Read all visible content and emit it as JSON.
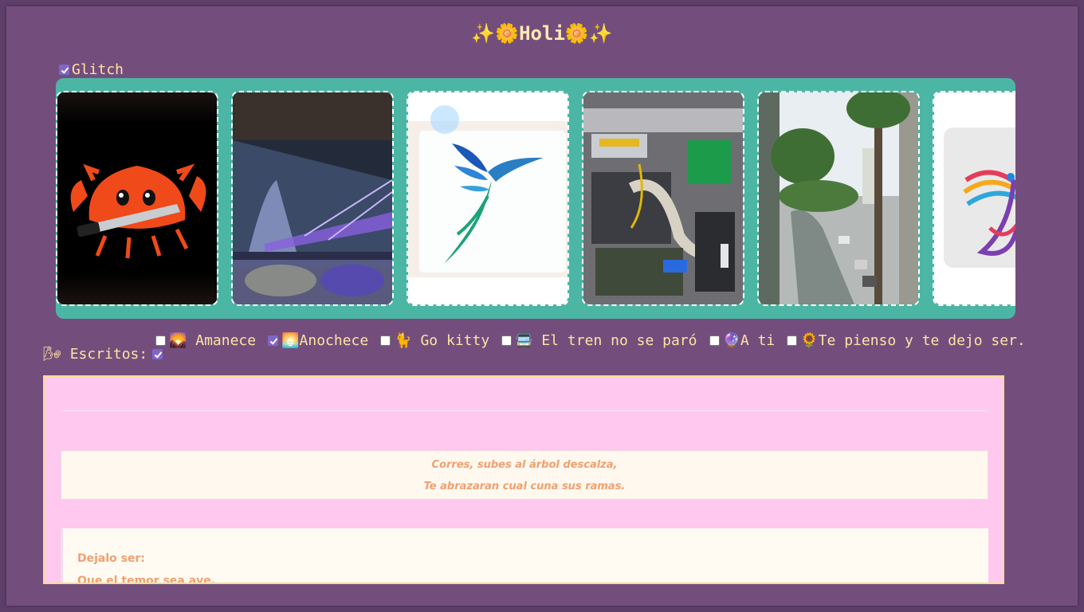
{
  "header": {
    "title": "✨🌼Holi🌼✨"
  },
  "glitch": {
    "label": "Glitch",
    "checked": true
  },
  "gallery": {
    "images": [
      {
        "alt": "Ferris crab with knife"
      },
      {
        "alt": "Illuminated bridge at night"
      },
      {
        "alt": "Hummingbird logo"
      },
      {
        "alt": "Open computer case"
      },
      {
        "alt": "Palm trees and street view"
      },
      {
        "alt": "Colorful bird logo"
      }
    ]
  },
  "writings": {
    "label": "🌬 Escritos:",
    "checked": true,
    "tabs": [
      {
        "label": "🌄 Amanece",
        "checked": false
      },
      {
        "label": "🌅Anochece",
        "checked": true
      },
      {
        "label": "🐈 Go kitty",
        "checked": false
      },
      {
        "label": "🚍 El tren no se paró",
        "checked": false
      },
      {
        "label": "🔮A ti",
        "checked": false
      },
      {
        "label": "🌻Te pienso y te dejo ser.",
        "checked": false
      }
    ]
  },
  "poem": {
    "stanza1": [
      "Corres, subes al árbol descalza,",
      "Te abrazaran cual cuna sus ramas."
    ],
    "stanza2": [
      "Dejalo ser:",
      "Que el temor sea ave."
    ]
  },
  "colors": {
    "background": "#734e7d",
    "gallery_bg": "#4cb6a4",
    "text_accent": "#ffe3a1",
    "content_bg": "#ffc8ee",
    "poem_text": "#f0a070"
  }
}
